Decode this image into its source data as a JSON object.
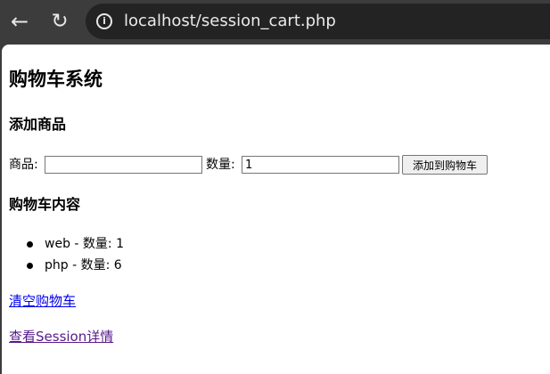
{
  "browser": {
    "url": "localhost/session_cart.php",
    "icons": {
      "back": "arrow-left-icon",
      "reload": "reload-icon",
      "info": "info-icon"
    }
  },
  "page": {
    "title": "购物车系统",
    "add_section": {
      "heading": "添加商品",
      "product_label": "商品:",
      "product_value": "",
      "quantity_label": "数量:",
      "quantity_value": "1",
      "submit_label": "添加到购物车"
    },
    "cart_section": {
      "heading": "购物车内容",
      "items": [
        {
          "text": "web - 数量: 1"
        },
        {
          "text": "php - 数量: 6"
        }
      ]
    },
    "links": {
      "clear_cart": "清空购物车",
      "view_session": "查看Session详情"
    },
    "colors": {
      "link": "#0000ee",
      "visited_link": "#551a8b",
      "chrome_bar": "#3c3c3c"
    }
  }
}
